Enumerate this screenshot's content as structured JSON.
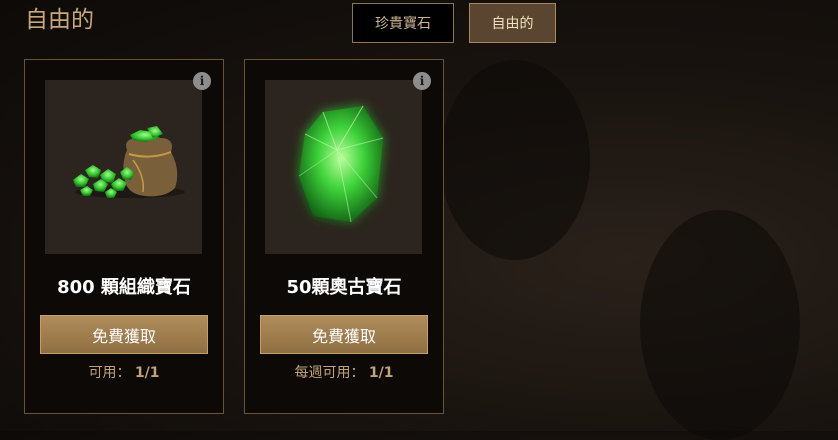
{
  "page": {
    "title": "自由的"
  },
  "tabs": [
    {
      "label": "珍貴寶石",
      "active": false
    },
    {
      "label": "自由的",
      "active": true
    }
  ],
  "cards": [
    {
      "title": "800 顆組織寶石",
      "image": "gem-sack-icon",
      "button_label": "免費獲取",
      "availability_label": "可用：",
      "availability_count": "1/1",
      "info_glyph": "i"
    },
    {
      "title": "50顆奧古寶石",
      "image": "green-crystal-icon",
      "button_label": "免費獲取",
      "availability_label": "每週可用：",
      "availability_count": "1/1",
      "info_glyph": "i"
    }
  ],
  "colors": {
    "accent": "#c9a67a",
    "button": "#a5834f",
    "card_border": "#6a5235",
    "gem": "#3ecb3a"
  }
}
